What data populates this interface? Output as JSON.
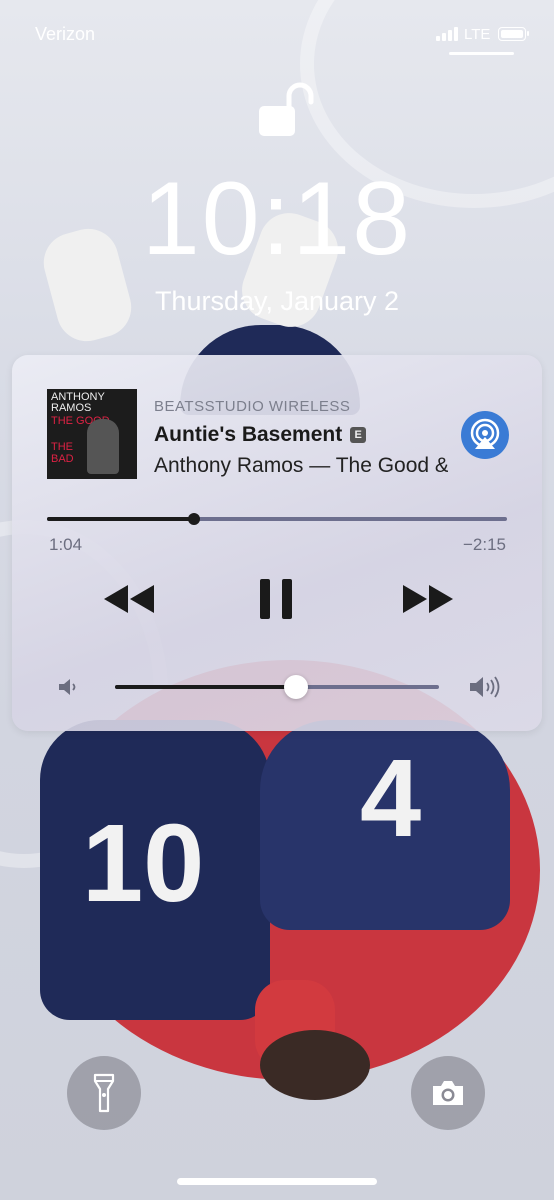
{
  "status_bar": {
    "carrier": "Verizon",
    "network": "LTE",
    "signal_bars": 4,
    "battery_level": 1.0
  },
  "lock_screen": {
    "lock_state_icon": "unlocked-padlock-icon",
    "time": "10:18",
    "date": "Thursday, January 2"
  },
  "now_playing": {
    "output_device": "BEATSSTUDIO WIRELESS",
    "track_title": "Auntie's Basement",
    "explicit_badge": "E",
    "subtitle": "Anthony Ramos — The Good & The Bad",
    "album_art_text": {
      "line1": "ANTHONY",
      "line2": "RAMOS",
      "line3": "THE GOOD",
      "line4": "THE",
      "line5": "BAD"
    },
    "elapsed": "1:04",
    "remaining": "−2:15",
    "progress_fraction": 0.32,
    "volume_fraction": 0.56,
    "is_playing": true,
    "icons": {
      "airplay": "airplay-icon",
      "rewind": "rewind-icon",
      "pause": "pause-icon",
      "fast_forward": "fast-forward-icon",
      "volume_low": "speaker-low-icon",
      "volume_high": "speaker-high-icon"
    }
  },
  "quick_actions": {
    "left": "flashlight-icon",
    "right": "camera-icon"
  },
  "colors": {
    "airplay_accent": "#3a7bd5",
    "wallpaper_red": "#c9363f",
    "wallpaper_navy": "#1f2a58"
  }
}
